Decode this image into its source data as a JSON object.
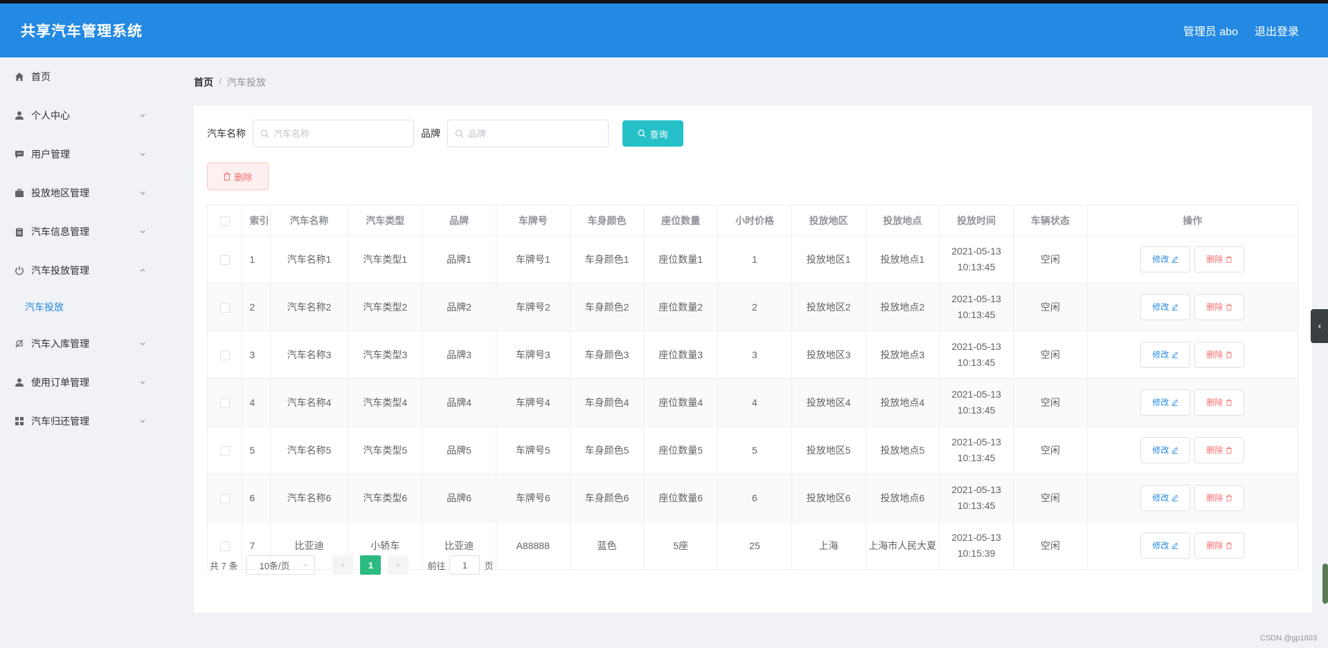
{
  "header": {
    "title": "共享汽车管理系统",
    "admin": "管理员 abo",
    "logout": "退出登录"
  },
  "sidebar": {
    "items": [
      {
        "label": "首页",
        "icon": "home-icon"
      },
      {
        "label": "个人中心",
        "icon": "user-icon"
      },
      {
        "label": "用户管理",
        "icon": "chat-icon"
      },
      {
        "label": "投放地区管理",
        "icon": "briefcase-icon"
      },
      {
        "label": "汽车信息管理",
        "icon": "clipboard-icon"
      },
      {
        "label": "汽车投放管理",
        "icon": "power-icon"
      },
      {
        "label": "汽车入库管理",
        "icon": "bell-off-icon"
      },
      {
        "label": "使用订单管理",
        "icon": "user-icon"
      },
      {
        "label": "汽车归还管理",
        "icon": "grid-icon"
      }
    ],
    "sub_item": "汽车投放"
  },
  "breadcrumb": {
    "home": "首页",
    "separator": "/",
    "current": "汽车投放"
  },
  "search": {
    "car_name_label": "汽车名称",
    "car_name_placeholder": "汽车名称",
    "brand_label": "品牌",
    "brand_placeholder": "品牌",
    "query_button": "查询"
  },
  "delete_button": "删除",
  "table": {
    "headers": [
      "索引",
      "汽车名称",
      "汽车类型",
      "品牌",
      "车牌号",
      "车身颜色",
      "座位数量",
      "小时价格",
      "投放地区",
      "投放地点",
      "投放时间",
      "车辆状态",
      "操作"
    ],
    "edit_label": "修改",
    "delete_label": "删除",
    "rows": [
      [
        "1",
        "汽车名称1",
        "汽车类型1",
        "品牌1",
        "车牌号1",
        "车身颜色1",
        "座位数量1",
        "1",
        "投放地区1",
        "投放地点1",
        "2021-05-13",
        "10:13:45",
        "空闲"
      ],
      [
        "2",
        "汽车名称2",
        "汽车类型2",
        "品牌2",
        "车牌号2",
        "车身颜色2",
        "座位数量2",
        "2",
        "投放地区2",
        "投放地点2",
        "2021-05-13",
        "10:13:45",
        "空闲"
      ],
      [
        "3",
        "汽车名称3",
        "汽车类型3",
        "品牌3",
        "车牌号3",
        "车身颜色3",
        "座位数量3",
        "3",
        "投放地区3",
        "投放地点3",
        "2021-05-13",
        "10:13:45",
        "空闲"
      ],
      [
        "4",
        "汽车名称4",
        "汽车类型4",
        "品牌4",
        "车牌号4",
        "车身颜色4",
        "座位数量4",
        "4",
        "投放地区4",
        "投放地点4",
        "2021-05-13",
        "10:13:45",
        "空闲"
      ],
      [
        "5",
        "汽车名称5",
        "汽车类型5",
        "品牌5",
        "车牌号5",
        "车身颜色5",
        "座位数量5",
        "5",
        "投放地区5",
        "投放地点5",
        "2021-05-13",
        "10:13:45",
        "空闲"
      ],
      [
        "6",
        "汽车名称6",
        "汽车类型6",
        "品牌6",
        "车牌号6",
        "车身颜色6",
        "座位数量6",
        "6",
        "投放地区6",
        "投放地点6",
        "2021-05-13",
        "10:13:45",
        "空闲"
      ],
      [
        "7",
        "比亚迪",
        "小轿车",
        "比亚迪",
        "A88888",
        "蓝色",
        "5座",
        "25",
        "上海",
        "上海市人民大夏",
        "2021-05-13",
        "10:15:39",
        "空闲"
      ]
    ]
  },
  "pagination": {
    "total": "共 7 条",
    "page_size": "10条/页",
    "current_page": "1",
    "goto_label": "前往",
    "goto_value": "1",
    "page_suffix": "页"
  },
  "watermark": "CSDN @gp1803",
  "colors": {
    "primary": "#2389e3",
    "query": "#26c0c9",
    "danger": "#f56c6c",
    "page_active": "#2cba81"
  }
}
